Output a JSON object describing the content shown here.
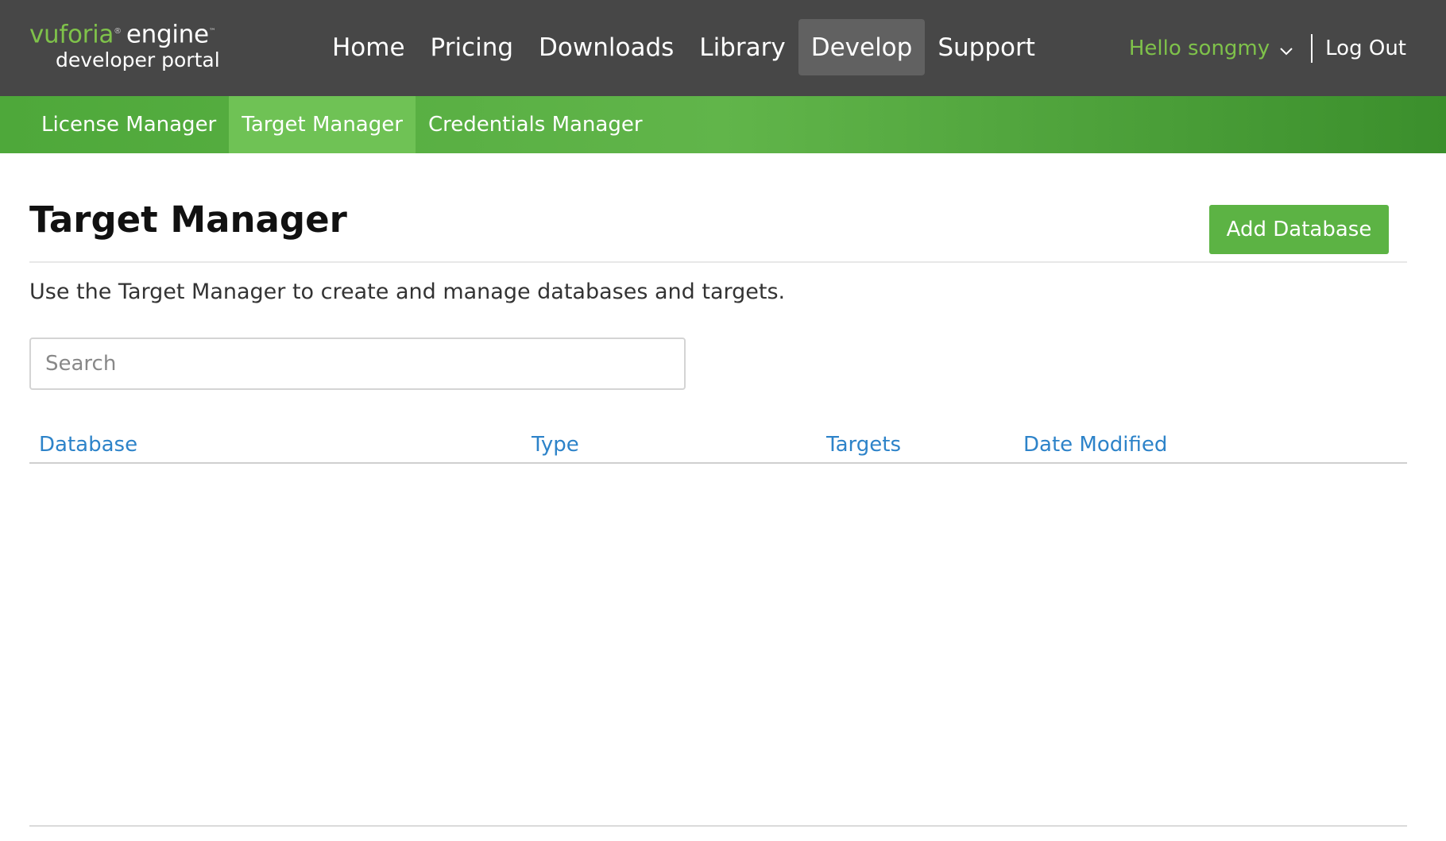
{
  "logo": {
    "brand": "vuforia",
    "brand_reg": "®",
    "product": "engine",
    "product_tm": "™",
    "subtitle": "developer portal"
  },
  "main_nav": [
    "Home",
    "Pricing",
    "Downloads",
    "Library",
    "Develop",
    "Support"
  ],
  "active_main_nav": "Develop",
  "user": {
    "greeting": "Hello songmy",
    "logout": "Log Out"
  },
  "sub_nav": [
    "License Manager",
    "Target Manager",
    "Credentials Manager"
  ],
  "active_sub_nav": "Target Manager",
  "page": {
    "title": "Target Manager",
    "add_button": "Add Database",
    "description": "Use the Target Manager to create and manage databases and targets.",
    "search_placeholder": "Search"
  },
  "table": {
    "columns": [
      "Database",
      "Type",
      "Targets",
      "Date Modified"
    ],
    "rows": []
  },
  "colors": {
    "topbar": "#474747",
    "accent_green": "#5cb344",
    "link_blue": "#2d83c9"
  }
}
